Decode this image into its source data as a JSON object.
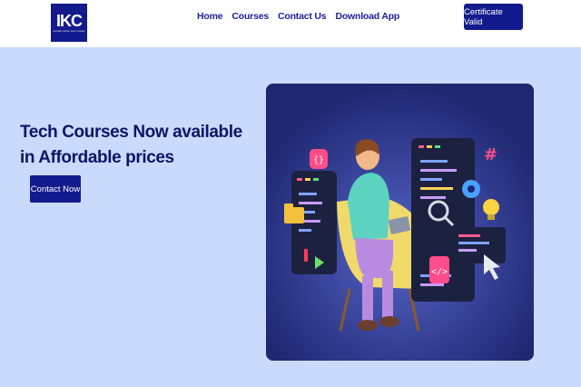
{
  "logo": {
    "mark": "IKC",
    "subtitle": "A PRIVATE LIMITED TECH COURSES"
  },
  "nav": {
    "items": [
      "Home",
      "Courses",
      "Contact Us",
      "Download App"
    ]
  },
  "header": {
    "cta_label": "Certificate Valid"
  },
  "hero": {
    "title_line1": "Tech Courses Now available",
    "title_line2": "in Affordable prices",
    "button_label": "Contact Now"
  },
  "colors": {
    "brand": "#131a8c",
    "background": "#c9dafc",
    "nav_text": "#1a2399",
    "title_text": "#0f1466"
  },
  "illustration": {
    "icons": [
      "code-panel-icon",
      "developer-character",
      "gear-icon",
      "lightbulb-icon",
      "cursor-icon",
      "folder-icon"
    ]
  }
}
